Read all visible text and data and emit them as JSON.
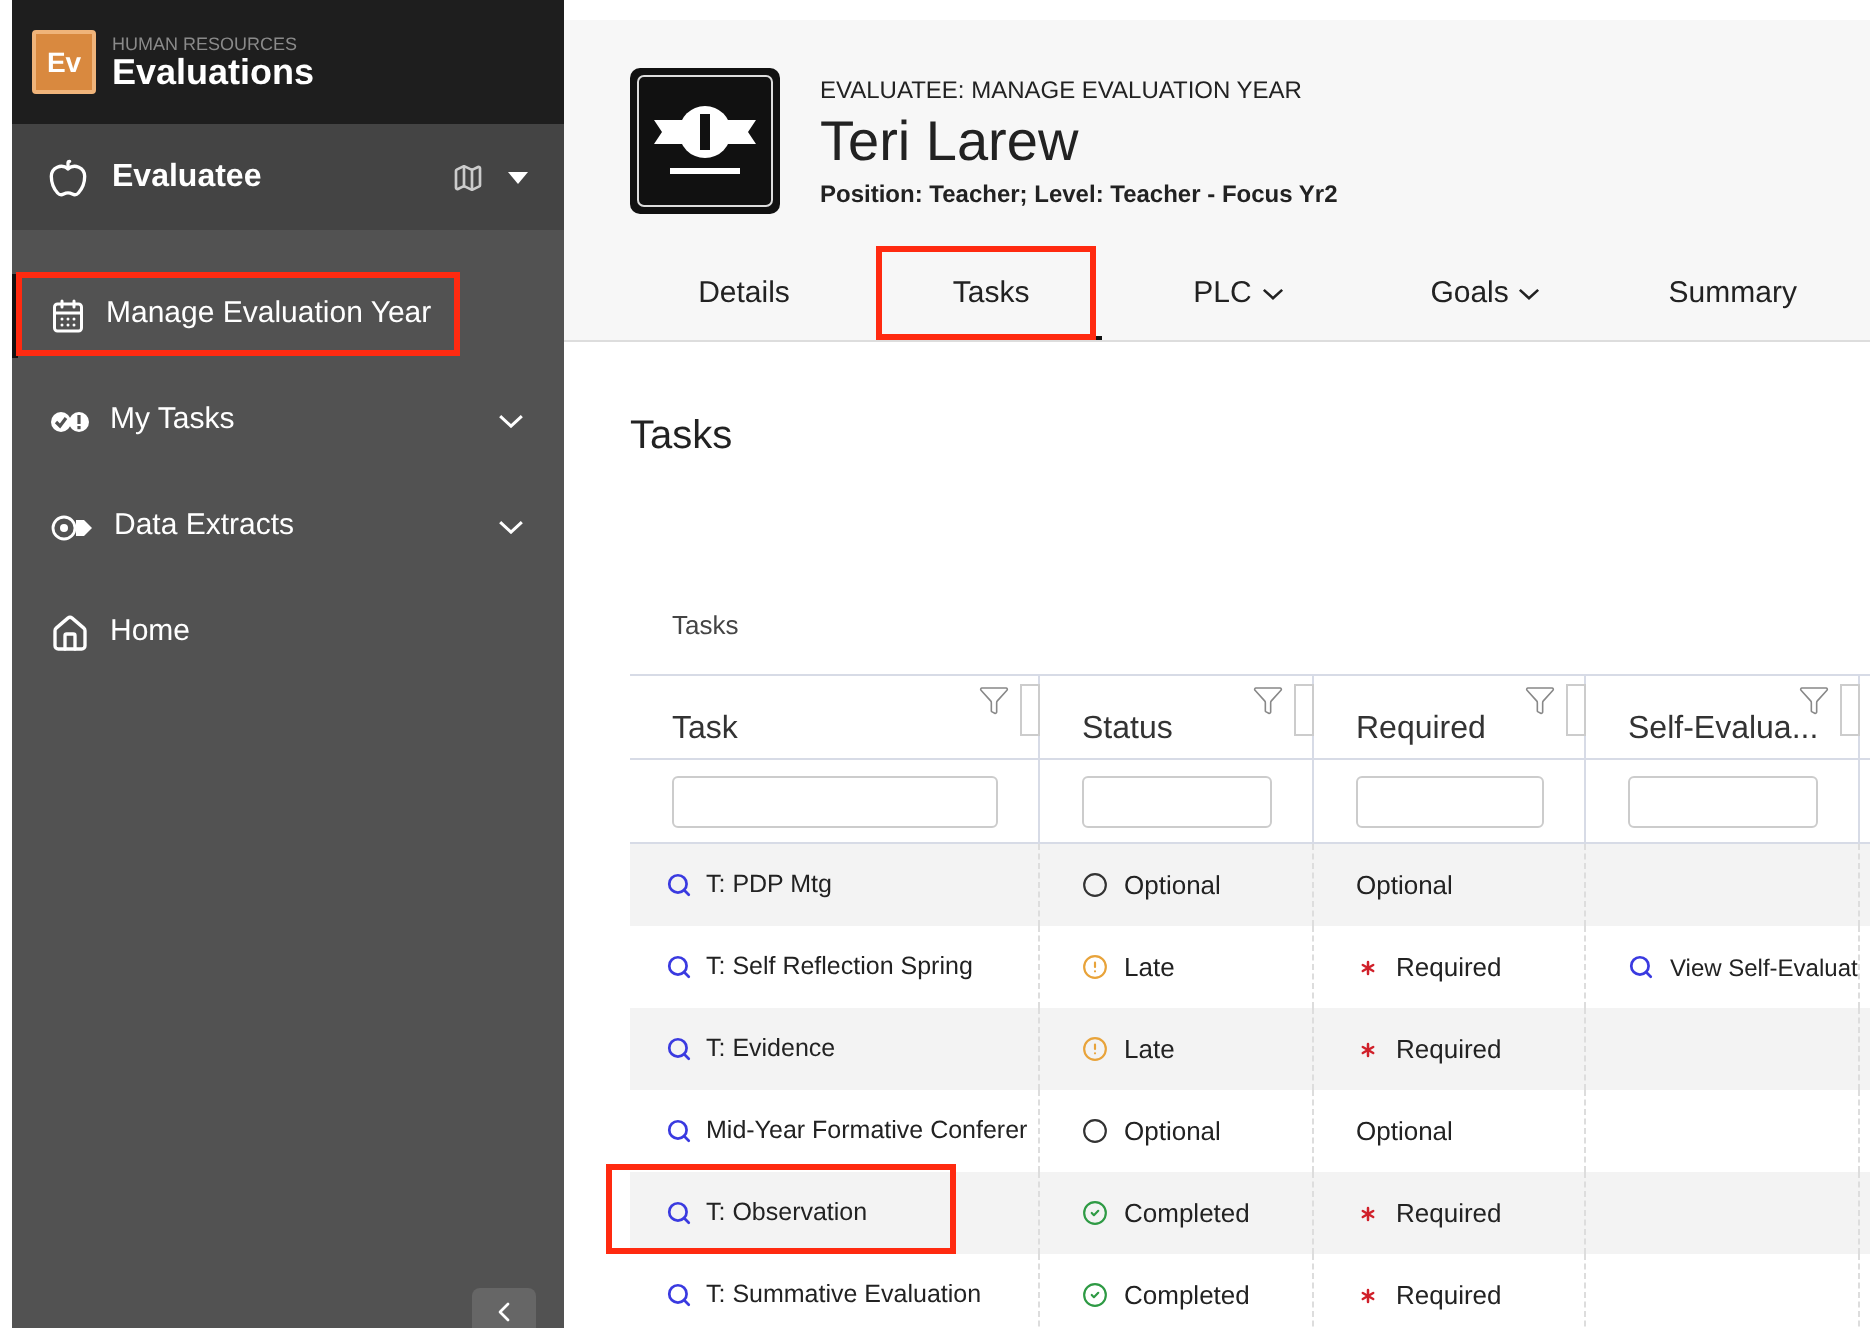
{
  "app": {
    "category": "HUMAN RESOURCES",
    "title": "Evaluations",
    "logo": "Ev"
  },
  "role": {
    "label": "Evaluatee"
  },
  "nav": [
    {
      "label": "Manage Evaluation Year",
      "kind": "calendar",
      "selected": true,
      "highlighted": true,
      "expandable": false
    },
    {
      "label": "My Tasks",
      "kind": "tasks",
      "selected": false,
      "highlighted": false,
      "expandable": true
    },
    {
      "label": "Data Extracts",
      "kind": "extracts",
      "selected": false,
      "highlighted": false,
      "expandable": true
    },
    {
      "label": "Home",
      "kind": "home",
      "selected": false,
      "highlighted": false,
      "expandable": false
    }
  ],
  "header": {
    "breadcrumb": "EVALUATEE: MANAGE EVALUATION YEAR",
    "name": "Teri Larew",
    "subtitle": "Position: Teacher; Level: Teacher - Focus Yr2"
  },
  "tabs": [
    {
      "label": "Details",
      "selected": false,
      "highlighted": false,
      "dropdown": false
    },
    {
      "label": "Tasks",
      "selected": true,
      "highlighted": true,
      "dropdown": false
    },
    {
      "label": "PLC",
      "selected": false,
      "highlighted": false,
      "dropdown": true
    },
    {
      "label": "Goals",
      "selected": false,
      "highlighted": false,
      "dropdown": true
    },
    {
      "label": "Summary",
      "selected": false,
      "highlighted": false,
      "dropdown": false
    }
  ],
  "page_title": "Tasks",
  "table": {
    "caption": "Tasks",
    "columns": [
      "Task",
      "Status",
      "Required",
      "Self-Evalua..."
    ],
    "rows": [
      {
        "task": "T: PDP Mtg",
        "status": {
          "kind": "optional",
          "label": "Optional"
        },
        "required": {
          "kind": "optional",
          "label": "Optional"
        },
        "highlighted": false
      },
      {
        "task": "T: Self Reflection Spring",
        "status": {
          "kind": "late",
          "label": "Late"
        },
        "required": {
          "kind": "required",
          "label": "Required"
        },
        "self_eval": "View Self-Evaluat",
        "highlighted": false
      },
      {
        "task": "T: Evidence",
        "status": {
          "kind": "late",
          "label": "Late"
        },
        "required": {
          "kind": "required",
          "label": "Required"
        },
        "highlighted": false
      },
      {
        "task": "Mid-Year Formative Conferer",
        "status": {
          "kind": "optional",
          "label": "Optional"
        },
        "required": {
          "kind": "optional",
          "label": "Optional"
        },
        "highlighted": false
      },
      {
        "task": "T: Observation",
        "status": {
          "kind": "completed",
          "label": "Completed"
        },
        "required": {
          "kind": "required",
          "label": "Required"
        },
        "highlighted": true
      },
      {
        "task": "T: Summative Evaluation",
        "status": {
          "kind": "completed",
          "label": "Completed"
        },
        "required": {
          "kind": "required",
          "label": "Required"
        },
        "highlighted": false
      }
    ]
  }
}
